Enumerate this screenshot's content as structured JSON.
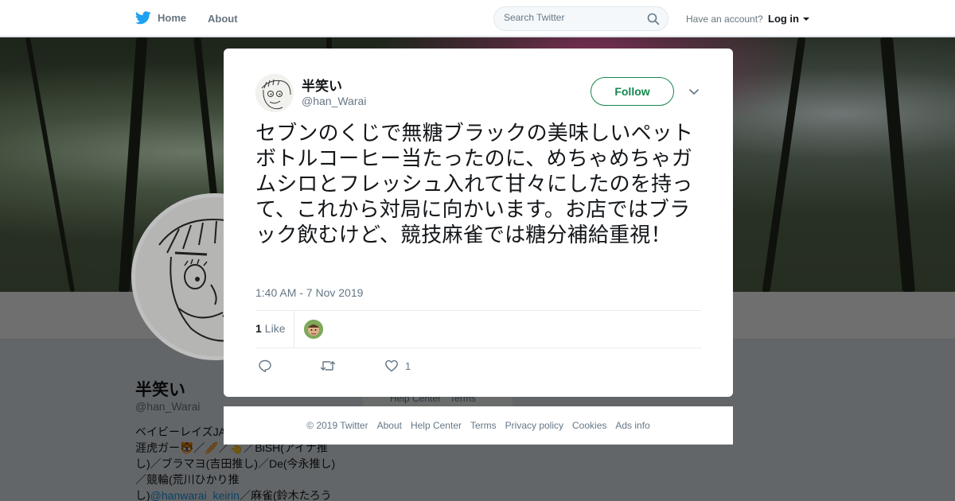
{
  "topbar": {
    "home_label": "Home",
    "about_label": "About",
    "search_placeholder": "Search Twitter",
    "have_account_text": "Have an account?",
    "login_label": "Log in"
  },
  "profile": {
    "name": "半笑い",
    "handle": "@han_Warai",
    "bio_line1": "ベイビーレイズJA",
    "bio_line2": "涯虎ガー🐯／🥖／👆／BiSH(アイナ推",
    "bio_line3": "し)／ブラマヨ(吉田推し)／De(今永推し)",
    "bio_line4": "／競輪(荒川ひかり推",
    "bio_line5_prefix": "し)",
    "bio_link": "@hanwarai_keirin",
    "bio_line5_suffix": "／麻雀(鈴木たろう",
    "footer_link_1": "Help Center",
    "footer_link_2": "Terms"
  },
  "tweet": {
    "author_name": "半笑い",
    "author_handle": "@han_Warai",
    "follow_label": "Follow",
    "text": "セブンのくじで無糖ブラックの美味しいペットボトルコーヒー当たったのに、めちゃめちゃガムシロとフレッシュ入れて甘々にしたのを持って、これから対局に向かいます。お店ではブラック飲むけど、競技麻雀では糖分補給重視！",
    "timestamp": "1:40 AM - 7 Nov 2019",
    "like_count": "1",
    "like_label": "Like",
    "action_like_count": "1"
  },
  "footer": {
    "copyright": "© 2019 Twitter",
    "links": [
      "About",
      "Help Center",
      "Terms",
      "Privacy policy",
      "Cookies",
      "Ads info"
    ]
  },
  "colors": {
    "brand_blue": "#1da1f2",
    "follow_green": "#17874e",
    "muted_text": "#657786"
  },
  "icons": [
    "twitter-bird-icon",
    "search-icon",
    "caret-down-icon",
    "close-icon",
    "reply-icon",
    "retweet-icon",
    "heart-icon",
    "chevron-down-icon"
  ]
}
